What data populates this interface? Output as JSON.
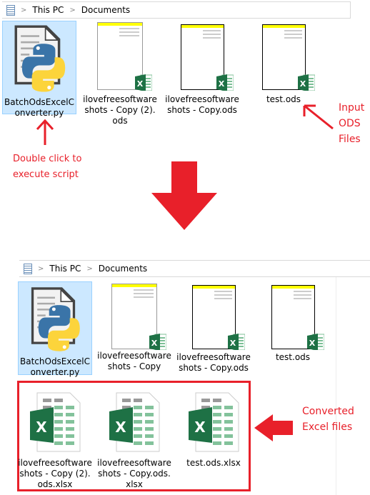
{
  "explorer_before": {
    "breadcrumb": [
      "This PC",
      "Documents"
    ],
    "items": [
      {
        "label": "BatchOdsExcelConverter.py",
        "icon": "python-file-icon",
        "selected": true
      },
      {
        "label": "ilovefreesoftware shots - Copy (2).ods",
        "icon": "ods-thumbnail"
      },
      {
        "label": "ilovefreesoftware shots - Copy.ods",
        "icon": "ods-thumbnail"
      },
      {
        "label": "test.ods",
        "icon": "ods-thumbnail"
      }
    ]
  },
  "explorer_after": {
    "breadcrumb": [
      "This PC",
      "Documents"
    ],
    "items": [
      {
        "label": "BatchOdsExcelConverter.py",
        "icon": "python-file-icon",
        "selected": true
      },
      {
        "label": "ilovefreesoftware shots - Copy",
        "icon": "ods-thumbnail"
      },
      {
        "label": "ilovefreesoftware shots - Copy.ods",
        "icon": "ods-thumbnail"
      },
      {
        "label": "test.ods",
        "icon": "ods-thumbnail"
      }
    ],
    "converted": [
      {
        "label": "ilovefreesoftware shots - Copy (2).ods.xlsx",
        "icon": "excel-file-icon"
      },
      {
        "label": "ilovefreesoftware shots - Copy.ods.xlsx",
        "icon": "excel-file-icon"
      },
      {
        "label": "test.ods.xlsx",
        "icon": "excel-file-icon"
      }
    ]
  },
  "annotations": {
    "double_click": "Double click to execute script",
    "input": "Input ODS Files",
    "converted": "Converted Excel files"
  },
  "colors": {
    "annotation": "#e8202a",
    "selection": "#cce8ff",
    "excel_green": "#1e7145"
  }
}
